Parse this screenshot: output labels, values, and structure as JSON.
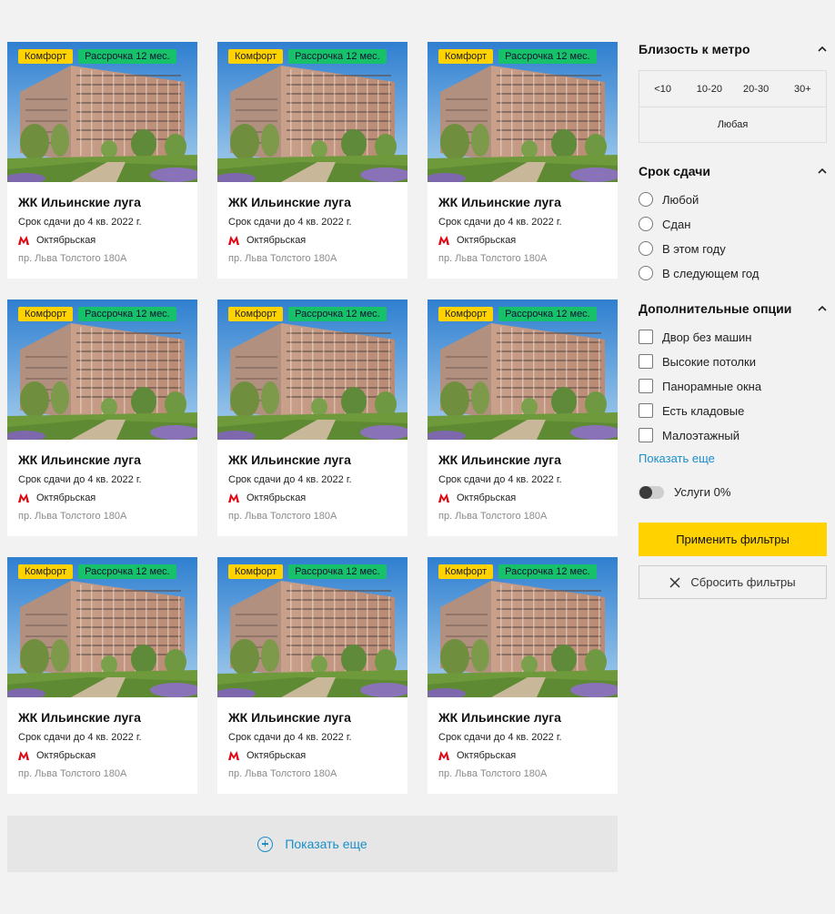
{
  "listing": {
    "cards": [
      {
        "tag_class": "Комфорт",
        "tag_installment": "Рассрочка 12 мес.",
        "title": "ЖК Ильинские луга",
        "deadline": "Срок сдачи до 4 кв. 2022 г.",
        "metro": "Октябрьская",
        "address": "пр. Льва Толстого 180А"
      },
      {
        "tag_class": "Комфорт",
        "tag_installment": "Рассрочка 12 мес.",
        "title": "ЖК Ильинские луга",
        "deadline": "Срок сдачи до 4 кв. 2022 г.",
        "metro": "Октябрьская",
        "address": "пр. Льва Толстого 180А"
      },
      {
        "tag_class": "Комфорт",
        "tag_installment": "Рассрочка 12 мес.",
        "title": "ЖК Ильинские луга",
        "deadline": "Срок сдачи до 4 кв. 2022 г.",
        "metro": "Октябрьская",
        "address": "пр. Льва Толстого 180А"
      },
      {
        "tag_class": "Комфорт",
        "tag_installment": "Рассрочка 12 мес.",
        "title": "ЖК Ильинские луга",
        "deadline": "Срок сдачи до 4 кв. 2022 г.",
        "metro": "Октябрьская",
        "address": "пр. Льва Толстого 180А"
      },
      {
        "tag_class": "Комфорт",
        "tag_installment": "Рассрочка 12 мес.",
        "title": "ЖК Ильинские луга",
        "deadline": "Срок сдачи до 4 кв. 2022 г.",
        "metro": "Октябрьская",
        "address": "пр. Льва Толстого 180А"
      },
      {
        "tag_class": "Комфорт",
        "tag_installment": "Рассрочка 12 мес.",
        "title": "ЖК Ильинские луга",
        "deadline": "Срок сдачи до 4 кв. 2022 г.",
        "metro": "Октябрьская",
        "address": "пр. Льва Толстого 180А"
      },
      {
        "tag_class": "Комфорт",
        "tag_installment": "Рассрочка 12 мес.",
        "title": "ЖК Ильинские луга",
        "deadline": "Срок сдачи до 4 кв. 2022 г.",
        "metro": "Октябрьская",
        "address": "пр. Льва Толстого 180А"
      },
      {
        "tag_class": "Комфорт",
        "tag_installment": "Рассрочка 12 мес.",
        "title": "ЖК Ильинские луга",
        "deadline": "Срок сдачи до 4 кв. 2022 г.",
        "metro": "Октябрьская",
        "address": "пр. Льва Толстого 180А"
      },
      {
        "tag_class": "Комфорт",
        "tag_installment": "Рассрочка 12 мес.",
        "title": "ЖК Ильинские луга",
        "deadline": "Срок сдачи до 4 кв. 2022 г.",
        "metro": "Октябрьская",
        "address": "пр. Льва Толстого 180А"
      }
    ],
    "show_more_label": "Показать еще"
  },
  "filters": {
    "metro": {
      "title": "Близость к метро",
      "options": [
        "<10",
        "10-20",
        "20-30",
        "30+"
      ],
      "any_label": "Любая"
    },
    "deadline": {
      "title": "Срок сдачи",
      "options": [
        "Любой",
        "Сдан",
        "В этом году",
        "В следующем год"
      ]
    },
    "extra": {
      "title": "Дополнительные опции",
      "options": [
        "Двор без машин",
        "Высокие потолки",
        "Панорамные окна",
        "Есть кладовые",
        "Малоэтажный"
      ],
      "show_more": "Показать еще"
    },
    "toggle": {
      "label": "Услуги 0%",
      "on": false
    },
    "apply_label": "Применить фильтры",
    "reset_label": "Сбросить фильтры"
  },
  "colors": {
    "accent_yellow": "#ffd200",
    "tag_green": "#17c16a",
    "link_blue": "#1a8fc9",
    "metro_red": "#e30613"
  },
  "icons": {
    "metro": "metro-logo-icon",
    "chevron": "chevron-up-icon",
    "plus": "plus-circle-icon",
    "close": "close-icon"
  }
}
